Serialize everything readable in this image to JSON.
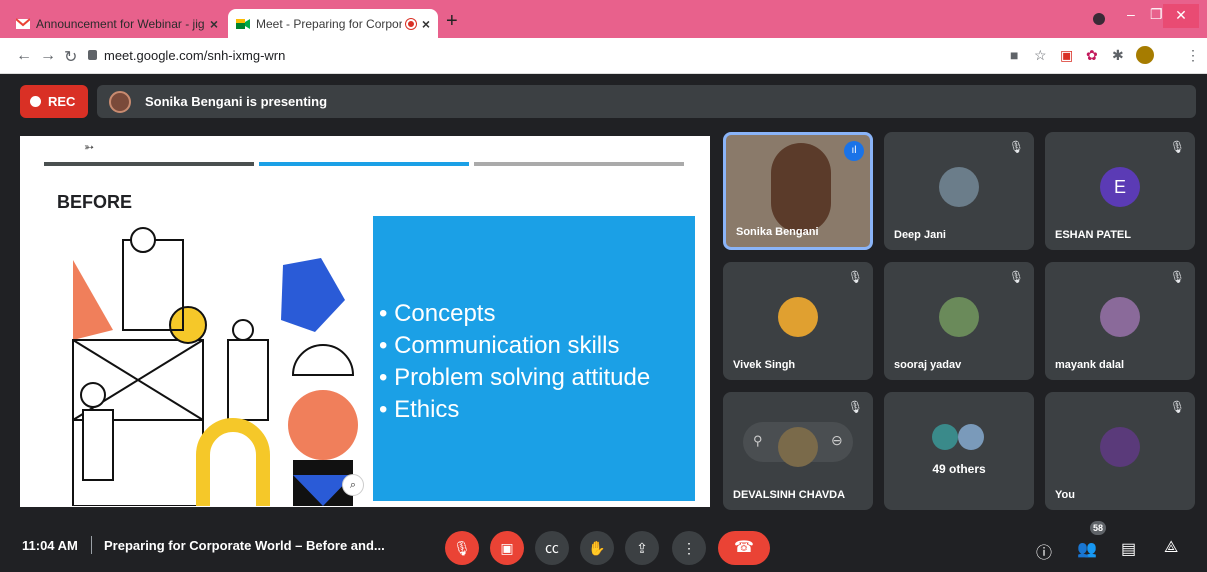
{
  "browser": {
    "tabs": [
      {
        "label": "Announcement for Webinar - jig",
        "active": false
      },
      {
        "label": "Meet - Preparing for Corpor",
        "active": true
      }
    ],
    "url": "meet.google.com/snh-ixmg-wrn",
    "new_tab": "+",
    "close_tab": "×"
  },
  "meet": {
    "rec_label": "REC",
    "presenting_text": "Sonika Bengani is presenting",
    "slide": {
      "heading": "BEFORE",
      "bullets": [
        "• Concepts",
        "• Communication skills",
        "• Problem solving attitude",
        "• Ethics"
      ]
    },
    "participants": [
      {
        "name": "Sonika Bengani",
        "speaking": true
      },
      {
        "name": "Deep Jani",
        "muted": true
      },
      {
        "name": "ESHAN PATEL",
        "muted": true,
        "initial": "E"
      },
      {
        "name": "Vivek Singh",
        "muted": true
      },
      {
        "name": "sooraj yadav",
        "muted": true
      },
      {
        "name": "mayank dalal",
        "muted": true
      },
      {
        "name": "DEVALSINH CHAVDA",
        "muted": true
      },
      {
        "name": "49 others"
      },
      {
        "name": "You",
        "muted": true
      }
    ],
    "bottom": {
      "time": "11:04 AM",
      "meeting_title": "Preparing for Corporate World – Before and...",
      "participant_count": "58"
    }
  },
  "colors": {
    "tab_bar": "#e8618c",
    "rec_red": "#d93025",
    "slide_blue": "#1ba0e6",
    "meet_bg": "#202124",
    "tile_bg": "#3c4043"
  }
}
